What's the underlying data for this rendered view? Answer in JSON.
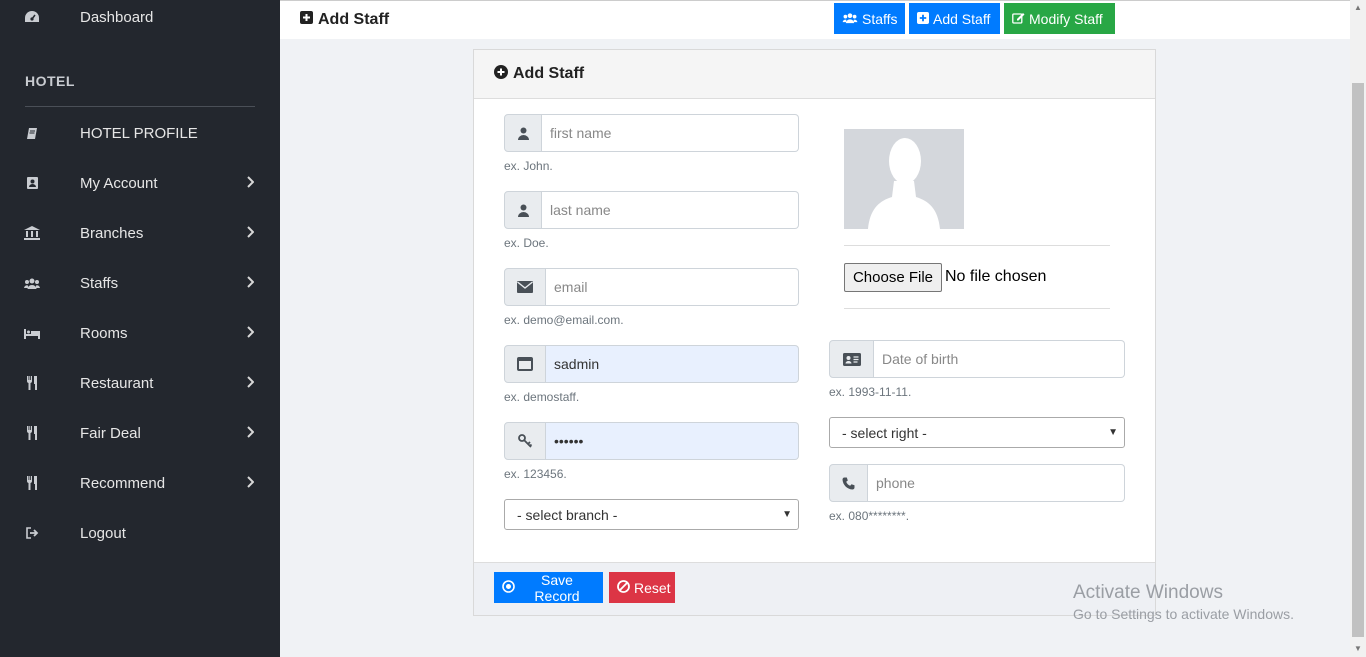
{
  "sidebar": {
    "dashboard": "Dashboard",
    "heading": "HOTEL",
    "items": [
      {
        "label": "HOTEL PROFILE",
        "icon": "book-icon"
      },
      {
        "label": "My Account",
        "icon": "address-book-icon"
      },
      {
        "label": "Branches",
        "icon": "bank-icon"
      },
      {
        "label": "Staffs",
        "icon": "users-icon"
      },
      {
        "label": "Rooms",
        "icon": "bed-icon"
      },
      {
        "label": "Restaurant",
        "icon": "cutlery-icon"
      },
      {
        "label": "Fair Deal",
        "icon": "cutlery-icon"
      },
      {
        "label": "Recommend",
        "icon": "cutlery-icon"
      },
      {
        "label": "Logout",
        "icon": "sign-out-icon"
      }
    ]
  },
  "header": {
    "title": "Add Staff",
    "btn_staffs": "Staffs",
    "btn_add_staff": "Add Staff",
    "btn_modify_staff": "Modify Staff"
  },
  "card": {
    "title": "Add Staff",
    "first_name": {
      "placeholder": "first name",
      "help": "ex. John."
    },
    "last_name": {
      "placeholder": "last name",
      "help": "ex. Doe."
    },
    "email": {
      "placeholder": "email",
      "help": "ex. demo@email.com."
    },
    "username": {
      "value": "sadmin",
      "help": "ex. demostaff."
    },
    "password": {
      "value": "••••••",
      "help": "ex. 123456."
    },
    "branch_select": "- select branch -",
    "file_button": "Choose File",
    "file_status": "No file chosen",
    "dob": {
      "placeholder": "Date of birth",
      "help": "ex. 1993-11-11."
    },
    "right_select": "- select right -",
    "phone": {
      "placeholder": "phone",
      "help": "ex. 080********."
    },
    "save_label": "Save Record",
    "reset_label": "Reset"
  },
  "watermark": {
    "line1": "Activate Windows",
    "line2": "Go to Settings to activate Windows."
  },
  "colors": {
    "sidebar_bg": "#23272e",
    "primary": "#007bff",
    "success": "#28a745",
    "danger": "#dc3545"
  }
}
